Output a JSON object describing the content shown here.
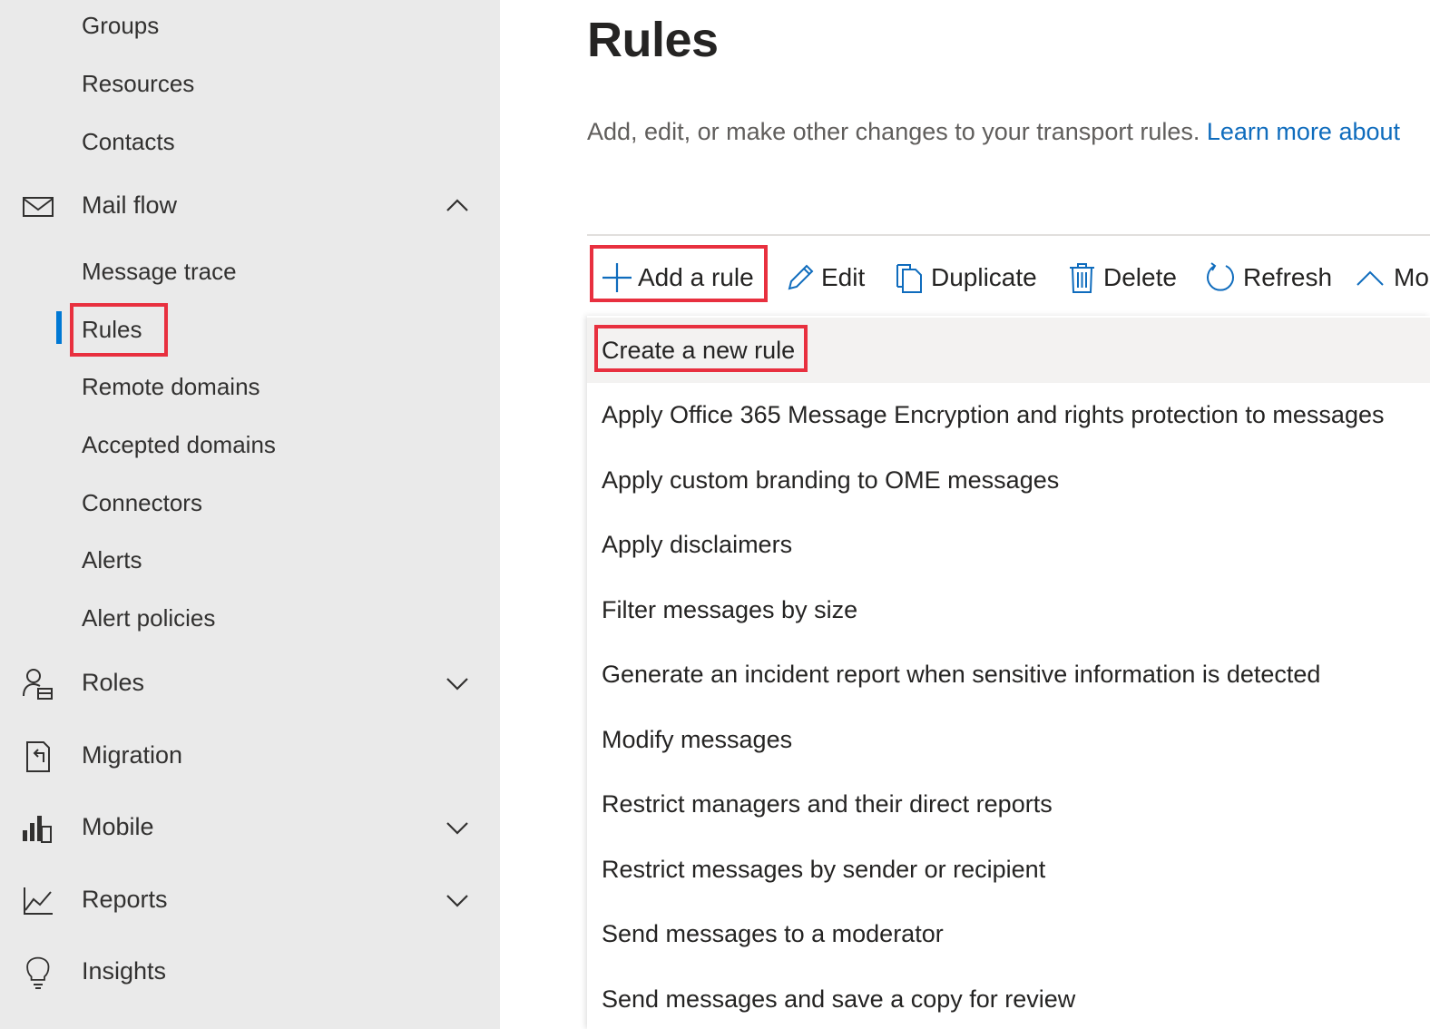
{
  "sidebar": {
    "groups": "Groups",
    "resources": "Resources",
    "contacts": "Contacts",
    "mail_flow": "Mail flow",
    "message_trace": "Message trace",
    "rules": "Rules",
    "remote_domains": "Remote domains",
    "accepted_domains": "Accepted domains",
    "connectors": "Connectors",
    "alerts": "Alerts",
    "alert_policies": "Alert policies",
    "roles": "Roles",
    "migration": "Migration",
    "mobile": "Mobile",
    "reports": "Reports",
    "insights": "Insights"
  },
  "page": {
    "title": "Rules",
    "description": "Add, edit, or make other changes to your transport rules.",
    "learn_more": "Learn more about"
  },
  "toolbar": {
    "add_rule": "Add a rule",
    "edit": "Edit",
    "duplicate": "Duplicate",
    "delete": "Delete",
    "refresh": "Refresh",
    "more": "Mo"
  },
  "dropdown": {
    "items": [
      "Create a new rule",
      "Apply Office 365 Message Encryption and rights protection to messages",
      "Apply custom branding to OME messages",
      "Apply disclaimers",
      "Filter messages by size",
      "Generate an incident report when sensitive information is detected",
      "Modify messages",
      "Restrict managers and their direct reports",
      "Restrict messages by sender or recipient",
      "Send messages to a moderator",
      "Send messages and save a copy for review"
    ]
  },
  "colors": {
    "accent": "#0078d4",
    "link": "#0f6cbd",
    "highlight_box": "#e8303f",
    "sidebar_bg": "#eaeaea"
  },
  "icons": [
    "mail-icon",
    "chevron-up-icon",
    "roles-icon",
    "chevron-down-icon",
    "migration-icon",
    "mobile-icon",
    "reports-icon",
    "lightbulb-icon",
    "plus-icon",
    "pencil-icon",
    "duplicate-icon",
    "trash-icon",
    "refresh-icon"
  ]
}
